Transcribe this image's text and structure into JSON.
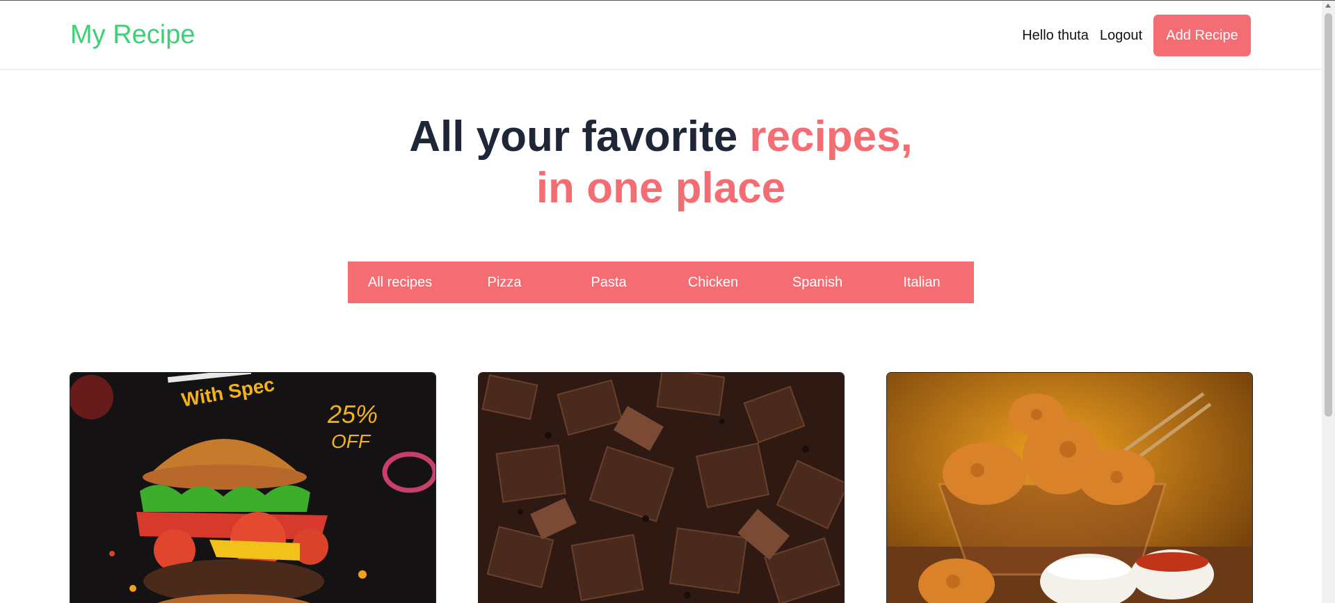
{
  "brand": "My Recipe",
  "nav": {
    "greeting": "Hello thuta",
    "logout": "Logout",
    "add_recipe": "Add Recipe"
  },
  "hero": {
    "line1_dark": "All your favorite ",
    "line1_accent": "recipes,",
    "line2_accent": "in one place"
  },
  "filters": [
    "All recipes",
    "Pizza",
    "Pasta",
    "Chicken",
    "Spanish",
    "Italian"
  ],
  "cards": [
    {
      "image": "burger-image",
      "promo_text": "With Spec",
      "discount": "25%",
      "discount_sub": "OFF"
    },
    {
      "image": "chocolate-image"
    },
    {
      "image": "fried-chicken-image"
    }
  ],
  "colors": {
    "brand": "#3fcf74",
    "accent": "#f46d72",
    "heading": "#1e2637"
  }
}
